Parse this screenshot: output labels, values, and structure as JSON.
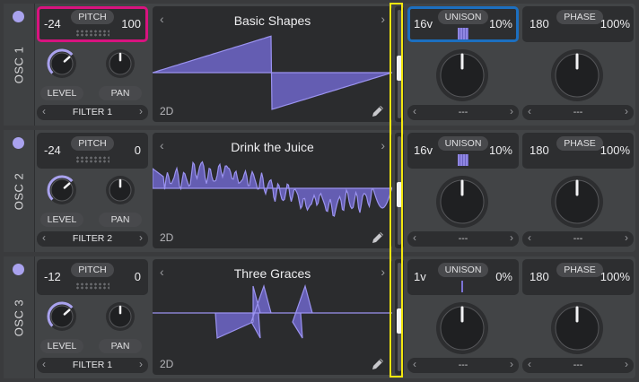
{
  "oscillators": [
    {
      "name": "OSC 1",
      "pitch": {
        "label": "PITCH",
        "left": "-24",
        "right": "100"
      },
      "knobs": {
        "level_label": "LEVEL",
        "pan_label": "PAN",
        "level_value": 0.68,
        "pan_value": 0.5
      },
      "filter": {
        "label": "FILTER 1"
      },
      "wavetable": {
        "name": "Basic Shapes",
        "dimension": "2D"
      },
      "frame_position": 0.55,
      "unison": {
        "label": "UNISON",
        "voices": "16v",
        "detune": "10%"
      },
      "phase": {
        "label": "PHASE",
        "value": "180",
        "randomness": "100%"
      },
      "unison_select": {
        "label": "---"
      },
      "phase_select": {
        "label": "---"
      }
    },
    {
      "name": "OSC 2",
      "pitch": {
        "label": "PITCH",
        "left": "-24",
        "right": "0"
      },
      "knobs": {
        "level_label": "LEVEL",
        "pan_label": "PAN",
        "level_value": 0.68,
        "pan_value": 0.5
      },
      "filter": {
        "label": "FILTER 2"
      },
      "wavetable": {
        "name": "Drink the Juice",
        "dimension": "2D"
      },
      "frame_position": 0.55,
      "unison": {
        "label": "UNISON",
        "voices": "16v",
        "detune": "10%"
      },
      "phase": {
        "label": "PHASE",
        "value": "180",
        "randomness": "100%"
      },
      "unison_select": {
        "label": "---"
      },
      "phase_select": {
        "label": "---"
      }
    },
    {
      "name": "OSC 3",
      "pitch": {
        "label": "PITCH",
        "left": "-12",
        "right": "0"
      },
      "knobs": {
        "level_label": "LEVEL",
        "pan_label": "PAN",
        "level_value": 0.68,
        "pan_value": 0.5
      },
      "filter": {
        "label": "FILTER 1"
      },
      "wavetable": {
        "name": "Three Graces",
        "dimension": "2D"
      },
      "frame_position": 0.55,
      "unison": {
        "label": "UNISON",
        "voices": "1v",
        "detune": "0%"
      },
      "phase": {
        "label": "PHASE",
        "value": "180",
        "randomness": "100%"
      },
      "unison_select": {
        "label": "---"
      },
      "phase_select": {
        "label": "---"
      }
    }
  ],
  "icons": {
    "enable": "power-dot-icon",
    "prev": "chevron-left-icon",
    "next": "chevron-right-icon",
    "edit": "pencil-icon"
  },
  "colors": {
    "accent": "#a9a2ee",
    "wave_fill": "#6e66c9",
    "wave_line": "#9b93f0",
    "pitch_highlight": "#d8137f",
    "unison_highlight": "#1c6fc0",
    "frame_highlight": "#f2e60f",
    "panel": "#424446",
    "display": "#2b2c2e"
  }
}
